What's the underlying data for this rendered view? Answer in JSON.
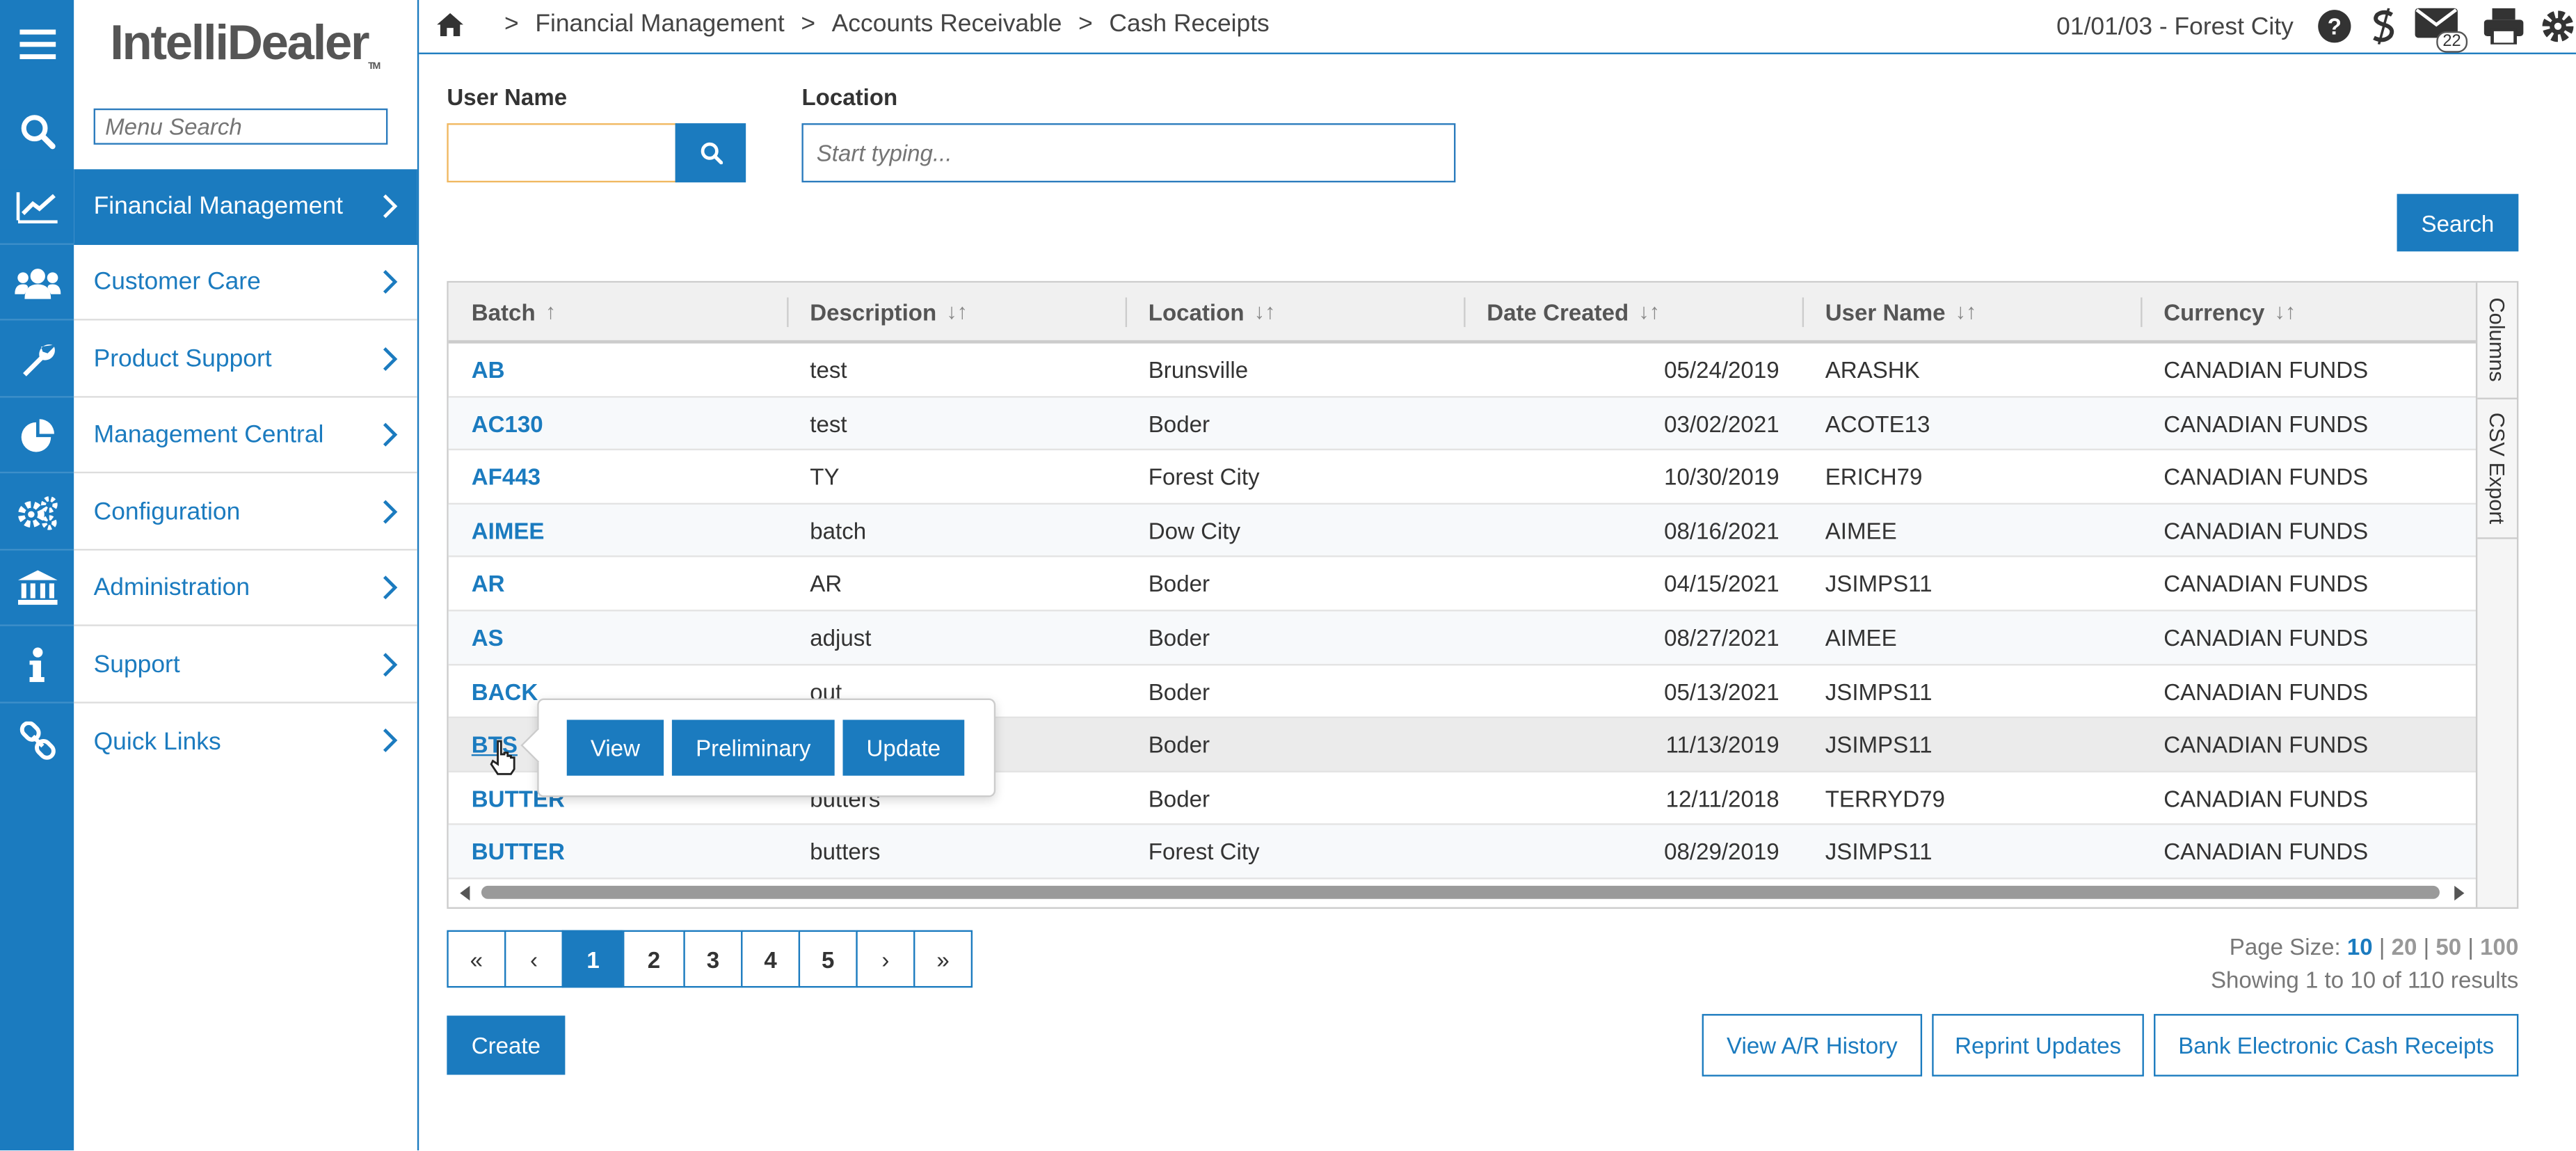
{
  "app": {
    "logo": "IntelliDealer",
    "logo_tm": "TM"
  },
  "menu": {
    "search_placeholder": "Menu Search",
    "items": [
      {
        "label": "Financial Management",
        "icon": "chart-line-icon",
        "active": true
      },
      {
        "label": "Customer Care",
        "icon": "users-icon"
      },
      {
        "label": "Product Support",
        "icon": "wrench-icon"
      },
      {
        "label": "Management Central",
        "icon": "pie-chart-icon"
      },
      {
        "label": "Configuration",
        "icon": "gears-icon"
      },
      {
        "label": "Administration",
        "icon": "bank-icon"
      },
      {
        "label": "Support",
        "icon": "info-icon"
      },
      {
        "label": "Quick Links",
        "icon": "link-icon"
      }
    ]
  },
  "header": {
    "breadcrumb": [
      "Financial Management",
      "Accounts Receivable",
      "Cash Receipts"
    ],
    "date_location": "01/01/03 - Forest City",
    "mail_count": "22"
  },
  "filters": {
    "user_name_label": "User Name",
    "user_name_value": "",
    "location_label": "Location",
    "location_placeholder": "Start typing...",
    "search_button": "Search"
  },
  "table": {
    "columns": [
      "Batch",
      "Description",
      "Location",
      "Date Created",
      "User Name",
      "Currency"
    ],
    "rows": [
      [
        "AB",
        "test",
        "Brunsville",
        "05/24/2019",
        "ARASHK",
        "CANADIAN FUNDS"
      ],
      [
        "AC130",
        "test",
        "Boder",
        "03/02/2021",
        "ACOTE13",
        "CANADIAN FUNDS"
      ],
      [
        "AF443",
        "TY",
        "Forest City",
        "10/30/2019",
        "ERICH79",
        "CANADIAN FUNDS"
      ],
      [
        "AIMEE",
        "batch",
        "Dow City",
        "08/16/2021",
        "AIMEE",
        "CANADIAN FUNDS"
      ],
      [
        "AR",
        "AR",
        "Boder",
        "04/15/2021",
        "JSIMPS11",
        "CANADIAN FUNDS"
      ],
      [
        "AS",
        "adjust",
        "Boder",
        "08/27/2021",
        "AIMEE",
        "CANADIAN FUNDS"
      ],
      [
        "BACK",
        "out",
        "Boder",
        "05/13/2021",
        "JSIMPS11",
        "CANADIAN FUNDS"
      ],
      [
        "BTS",
        "",
        "Boder",
        "11/13/2019",
        "JSIMPS11",
        "CANADIAN FUNDS"
      ],
      [
        "BUTTER",
        "butters",
        "Boder",
        "12/11/2018",
        "TERRYD79",
        "CANADIAN FUNDS"
      ],
      [
        "BUTTER",
        "butters",
        "Forest City",
        "08/29/2019",
        "JSIMPS11",
        "CANADIAN FUNDS"
      ]
    ],
    "side_tabs": [
      "Columns",
      "CSV Export"
    ]
  },
  "popup": {
    "view": "View",
    "preliminary": "Preliminary",
    "update": "Update"
  },
  "pagination": {
    "first": "«",
    "prev": "‹",
    "next": "›",
    "last": "»",
    "pages": [
      "1",
      "2",
      "3",
      "4",
      "5"
    ],
    "current": "1",
    "page_size_label": "Page Size:",
    "page_sizes": [
      "10",
      "20",
      "50",
      "100"
    ],
    "showing": "Showing 1 to 10 of 110 results"
  },
  "actions": {
    "create": "Create",
    "view_history": "View A/R History",
    "reprint": "Reprint Updates",
    "bank": "Bank Electronic Cash Receipts"
  },
  "colors": {
    "accent": "#1b7bbf",
    "header_bg": "#f0f0f0",
    "row_alt": "#f7f9fb"
  }
}
